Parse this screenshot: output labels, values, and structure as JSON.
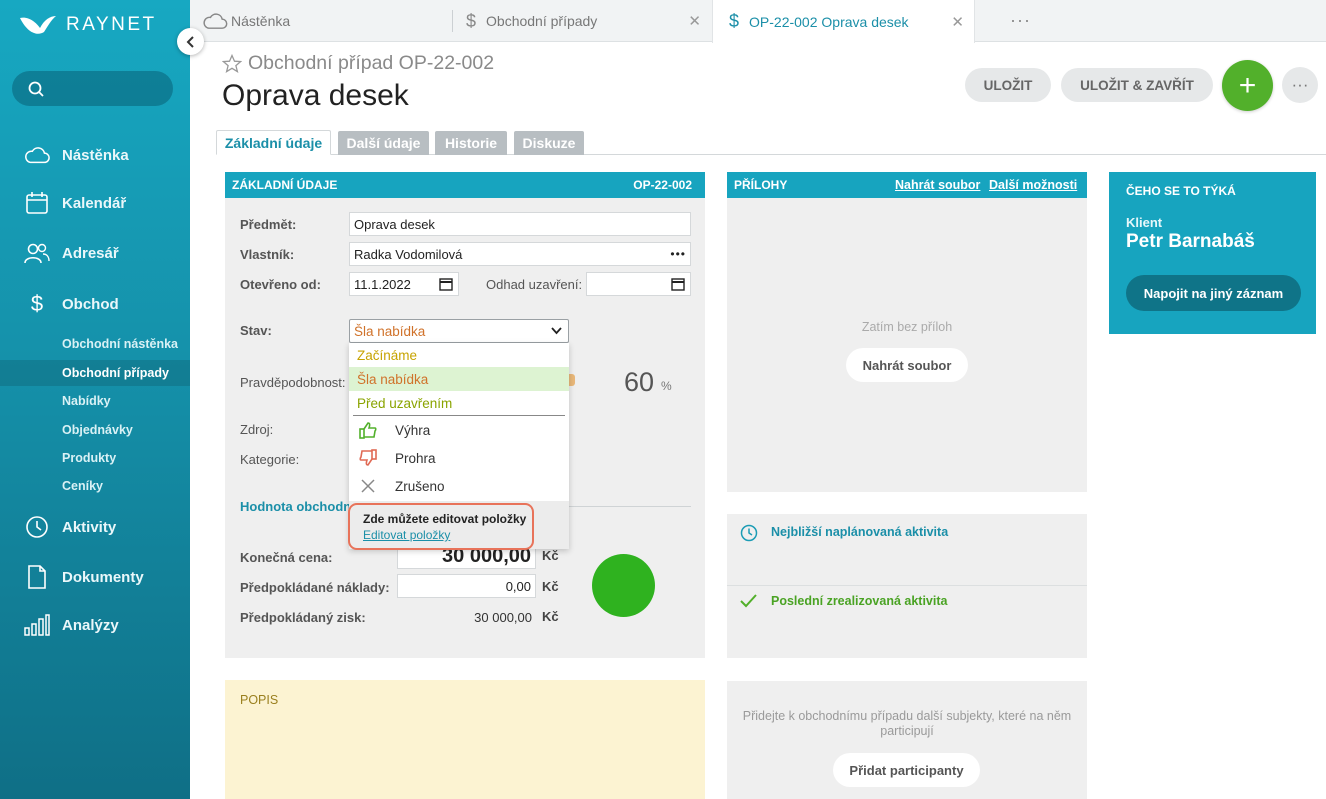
{
  "app": {
    "logo_text": "RAYNET"
  },
  "sidebar": {
    "search_placeholder": "",
    "items": [
      {
        "label": "Nástěnka",
        "icon": "cloud-icon"
      },
      {
        "label": "Kalendář",
        "icon": "calendar-icon"
      },
      {
        "label": "Adresář",
        "icon": "contacts-icon"
      },
      {
        "label": "Obchod",
        "icon": "dollar-icon"
      },
      {
        "label": "Aktivity",
        "icon": "clock-icon"
      },
      {
        "label": "Dokumenty",
        "icon": "document-icon"
      },
      {
        "label": "Analýzy",
        "icon": "bar-chart-icon"
      }
    ],
    "sub_items": [
      {
        "label": "Obchodní nástěnka"
      },
      {
        "label": "Obchodní případy"
      },
      {
        "label": "Nabídky"
      },
      {
        "label": "Objednávky"
      },
      {
        "label": "Produkty"
      },
      {
        "label": "Ceníky"
      }
    ]
  },
  "tabs": [
    {
      "label": "Nástěnka"
    },
    {
      "label": "Obchodní případy"
    },
    {
      "label": "OP-22-002 Oprava desek"
    }
  ],
  "header": {
    "subtitle": "Obchodní případ OP-22-002",
    "title": "Oprava desek",
    "save_label": "ULOŽIT",
    "save_close_label": "ULOŽIT & ZAVŘÍT",
    "add_label": "+",
    "more_label": "···"
  },
  "page_tabs": [
    {
      "label": "Základní údaje"
    },
    {
      "label": "Další údaje"
    },
    {
      "label": "Historie"
    },
    {
      "label": "Diskuze"
    }
  ],
  "basic": {
    "title": "ZÁKLADNÍ ÚDAJE",
    "code": "OP-22-002",
    "subject_label": "Předmět:",
    "subject_value": "Oprava desek",
    "owner_label": "Vlastník:",
    "owner_value": "Radka Vodomilová",
    "owner_more": "•••",
    "opened_label": "Otevřeno od:",
    "opened_value": "11.1.2022",
    "close_est_label": "Odhad uzavření:",
    "close_est_value": "",
    "state_label": "Stav:",
    "state_value": "Šla nabídka",
    "probability_label": "Pravděpodobnost:",
    "probability_value": "60",
    "probability_unit": "%",
    "source_label": "Zdroj:",
    "category_label": "Kategorie:",
    "value_section_label": "Hodnota obchodní",
    "final_price_label": "Konečná cena:",
    "final_price_value": "30 000,00",
    "costs_label": "Předpokládané náklady:",
    "costs_value": "0,00",
    "profit_label": "Předpokládaný zisk:",
    "profit_value": "30 000,00",
    "currency": "Kč"
  },
  "state_dropdown": {
    "options": [
      {
        "label": "Začínáme",
        "color": "#c7a300"
      },
      {
        "label": "Šla nabídka",
        "color": "#d0722a"
      },
      {
        "label": "Před uzavřením",
        "color": "#8aa400"
      }
    ],
    "final_options": [
      {
        "label": "Výhra",
        "icon": "thumbs-up-icon"
      },
      {
        "label": "Prohra",
        "icon": "thumbs-down-icon"
      },
      {
        "label": "Zrušeno",
        "icon": "close-icon"
      }
    ],
    "hint_text": "Zde můžete editovat položky",
    "hint_link": "Editovat položky"
  },
  "attachments": {
    "title": "PŘÍLOHY",
    "upload_link": "Nahrát soubor",
    "more_link": "Další možnosti",
    "empty_text": "Zatím bez příloh",
    "upload_button": "Nahrát soubor"
  },
  "activities": {
    "next_label": "Nejbližší naplánovaná aktivita",
    "last_label": "Poslední zrealizovaná aktivita"
  },
  "related": {
    "title": "ČEHO SE TO TÝKÁ",
    "client_label": "Klient",
    "client_name": "Petr Barnabáš",
    "link_button": "Napojit na jiný záznam"
  },
  "participants": {
    "text": "Přidejte k obchodnímu případu další subjekty, které na něm participují",
    "button": "Přidat participanty"
  },
  "description": {
    "title": "POPIS"
  },
  "colors": {
    "accent": "#17a4bf",
    "green": "#52b02b",
    "hint_border": "#e8735a"
  }
}
